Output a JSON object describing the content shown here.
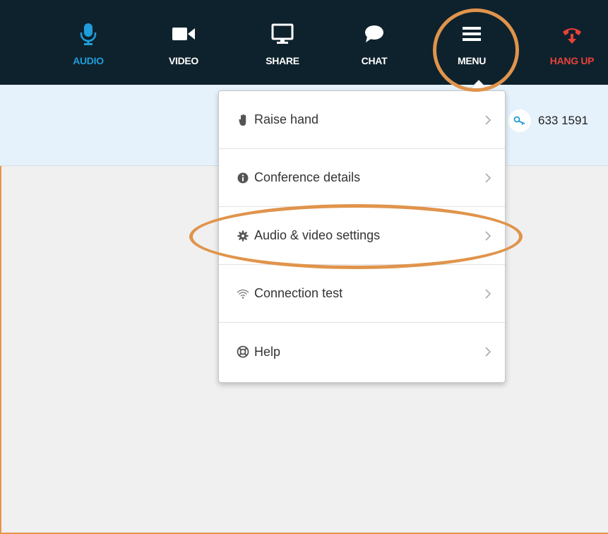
{
  "toolbar": {
    "items": [
      {
        "label": "AUDIO",
        "icon": "microphone-icon"
      },
      {
        "label": "VIDEO",
        "icon": "video-camera-icon"
      },
      {
        "label": "SHARE",
        "icon": "monitor-icon"
      },
      {
        "label": "CHAT",
        "icon": "chat-bubble-icon"
      },
      {
        "label": "MENU",
        "icon": "hamburger-menu-icon"
      },
      {
        "label": "HANG UP",
        "icon": "phone-hangup-icon"
      }
    ]
  },
  "conference": {
    "id_text": "633 1591",
    "icon": "key-icon"
  },
  "menu": {
    "items": [
      {
        "label": "Raise hand",
        "icon": "hand-icon"
      },
      {
        "label": "Conference details",
        "icon": "info-icon"
      },
      {
        "label": "Audio & video settings",
        "icon": "gear-icon"
      },
      {
        "label": "Connection test",
        "icon": "wifi-icon"
      },
      {
        "label": "Help",
        "icon": "lifebuoy-icon"
      }
    ]
  },
  "colors": {
    "topbar_bg": "#0e222d",
    "audio_active": "#1f9ddb",
    "hangup": "#e8413a",
    "info_bar_bg": "#e5f2fb",
    "highlight_ring": "#e0944c"
  }
}
